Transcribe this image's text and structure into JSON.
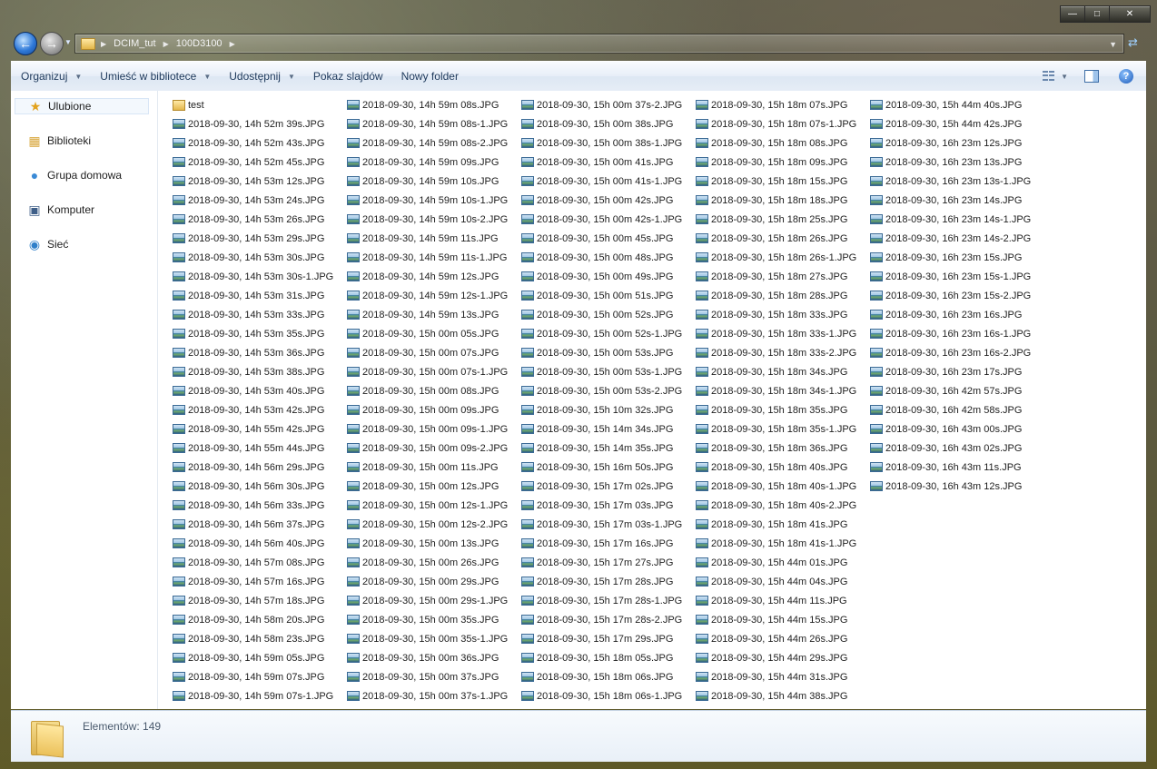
{
  "window": {
    "min_icon": "minimize-icon",
    "max_icon": "maximize-icon",
    "close_icon": "close-icon"
  },
  "address": {
    "segments": [
      "DCIM_tut",
      "100D3100"
    ]
  },
  "toolbar": {
    "organize": "Organizuj",
    "library": "Umieść w bibliotece",
    "share": "Udostępnij",
    "slideshow": "Pokaz slajdów",
    "new_folder": "Nowy folder"
  },
  "nav": {
    "items": [
      "Ulubione",
      "Biblioteki",
      "Grupa domowa",
      "Komputer",
      "Sieć"
    ]
  },
  "status": {
    "count": "Elementów: 149"
  },
  "files": [
    [
      "test",
      "2018-09-30, 14h 52m 39s.JPG",
      "2018-09-30, 14h 52m 43s.JPG",
      "2018-09-30, 14h 52m 45s.JPG",
      "2018-09-30, 14h 53m 12s.JPG",
      "2018-09-30, 14h 53m 24s.JPG",
      "2018-09-30, 14h 53m 26s.JPG",
      "2018-09-30, 14h 53m 29s.JPG",
      "2018-09-30, 14h 53m 30s.JPG",
      "2018-09-30, 14h 53m 30s-1.JPG",
      "2018-09-30, 14h 53m 31s.JPG",
      "2018-09-30, 14h 53m 33s.JPG",
      "2018-09-30, 14h 53m 35s.JPG",
      "2018-09-30, 14h 53m 36s.JPG",
      "2018-09-30, 14h 53m 38s.JPG",
      "2018-09-30, 14h 53m 40s.JPG",
      "2018-09-30, 14h 53m 42s.JPG",
      "2018-09-30, 14h 55m 42s.JPG",
      "2018-09-30, 14h 55m 44s.JPG",
      "2018-09-30, 14h 56m 29s.JPG",
      "2018-09-30, 14h 56m 30s.JPG",
      "2018-09-30, 14h 56m 33s.JPG",
      "2018-09-30, 14h 56m 37s.JPG",
      "2018-09-30, 14h 56m 40s.JPG",
      "2018-09-30, 14h 57m 08s.JPG",
      "2018-09-30, 14h 57m 16s.JPG",
      "2018-09-30, 14h 57m 18s.JPG",
      "2018-09-30, 14h 58m 20s.JPG",
      "2018-09-30, 14h 58m 23s.JPG",
      "2018-09-30, 14h 59m 05s.JPG",
      "2018-09-30, 14h 59m 07s.JPG",
      "2018-09-30, 14h 59m 07s-1.JPG"
    ],
    [
      "2018-09-30, 14h 59m 08s.JPG",
      "2018-09-30, 14h 59m 08s-1.JPG",
      "2018-09-30, 14h 59m 08s-2.JPG",
      "2018-09-30, 14h 59m 09s.JPG",
      "2018-09-30, 14h 59m 10s.JPG",
      "2018-09-30, 14h 59m 10s-1.JPG",
      "2018-09-30, 14h 59m 10s-2.JPG",
      "2018-09-30, 14h 59m 11s.JPG",
      "2018-09-30, 14h 59m 11s-1.JPG",
      "2018-09-30, 14h 59m 12s.JPG",
      "2018-09-30, 14h 59m 12s-1.JPG",
      "2018-09-30, 14h 59m 13s.JPG",
      "2018-09-30, 15h 00m 05s.JPG",
      "2018-09-30, 15h 00m 07s.JPG",
      "2018-09-30, 15h 00m 07s-1.JPG",
      "2018-09-30, 15h 00m 08s.JPG",
      "2018-09-30, 15h 00m 09s.JPG",
      "2018-09-30, 15h 00m 09s-1.JPG",
      "2018-09-30, 15h 00m 09s-2.JPG",
      "2018-09-30, 15h 00m 11s.JPG",
      "2018-09-30, 15h 00m 12s.JPG",
      "2018-09-30, 15h 00m 12s-1.JPG",
      "2018-09-30, 15h 00m 12s-2.JPG",
      "2018-09-30, 15h 00m 13s.JPG",
      "2018-09-30, 15h 00m 26s.JPG",
      "2018-09-30, 15h 00m 29s.JPG",
      "2018-09-30, 15h 00m 29s-1.JPG",
      "2018-09-30, 15h 00m 35s.JPG",
      "2018-09-30, 15h 00m 35s-1.JPG",
      "2018-09-30, 15h 00m 36s.JPG",
      "2018-09-30, 15h 00m 37s.JPG",
      "2018-09-30, 15h 00m 37s-1.JPG"
    ],
    [
      "2018-09-30, 15h 00m 37s-2.JPG",
      "2018-09-30, 15h 00m 38s.JPG",
      "2018-09-30, 15h 00m 38s-1.JPG",
      "2018-09-30, 15h 00m 41s.JPG",
      "2018-09-30, 15h 00m 41s-1.JPG",
      "2018-09-30, 15h 00m 42s.JPG",
      "2018-09-30, 15h 00m 42s-1.JPG",
      "2018-09-30, 15h 00m 45s.JPG",
      "2018-09-30, 15h 00m 48s.JPG",
      "2018-09-30, 15h 00m 49s.JPG",
      "2018-09-30, 15h 00m 51s.JPG",
      "2018-09-30, 15h 00m 52s.JPG",
      "2018-09-30, 15h 00m 52s-1.JPG",
      "2018-09-30, 15h 00m 53s.JPG",
      "2018-09-30, 15h 00m 53s-1.JPG",
      "2018-09-30, 15h 00m 53s-2.JPG",
      "2018-09-30, 15h 10m 32s.JPG",
      "2018-09-30, 15h 14m 34s.JPG",
      "2018-09-30, 15h 14m 35s.JPG",
      "2018-09-30, 15h 16m 50s.JPG",
      "2018-09-30, 15h 17m 02s.JPG",
      "2018-09-30, 15h 17m 03s.JPG",
      "2018-09-30, 15h 17m 03s-1.JPG",
      "2018-09-30, 15h 17m 16s.JPG",
      "2018-09-30, 15h 17m 27s.JPG",
      "2018-09-30, 15h 17m 28s.JPG",
      "2018-09-30, 15h 17m 28s-1.JPG",
      "2018-09-30, 15h 17m 28s-2.JPG",
      "2018-09-30, 15h 17m 29s.JPG",
      "2018-09-30, 15h 18m 05s.JPG",
      "2018-09-30, 15h 18m 06s.JPG",
      "2018-09-30, 15h 18m 06s-1.JPG"
    ],
    [
      "2018-09-30, 15h 18m 07s.JPG",
      "2018-09-30, 15h 18m 07s-1.JPG",
      "2018-09-30, 15h 18m 08s.JPG",
      "2018-09-30, 15h 18m 09s.JPG",
      "2018-09-30, 15h 18m 15s.JPG",
      "2018-09-30, 15h 18m 18s.JPG",
      "2018-09-30, 15h 18m 25s.JPG",
      "2018-09-30, 15h 18m 26s.JPG",
      "2018-09-30, 15h 18m 26s-1.JPG",
      "2018-09-30, 15h 18m 27s.JPG",
      "2018-09-30, 15h 18m 28s.JPG",
      "2018-09-30, 15h 18m 33s.JPG",
      "2018-09-30, 15h 18m 33s-1.JPG",
      "2018-09-30, 15h 18m 33s-2.JPG",
      "2018-09-30, 15h 18m 34s.JPG",
      "2018-09-30, 15h 18m 34s-1.JPG",
      "2018-09-30, 15h 18m 35s.JPG",
      "2018-09-30, 15h 18m 35s-1.JPG",
      "2018-09-30, 15h 18m 36s.JPG",
      "2018-09-30, 15h 18m 40s.JPG",
      "2018-09-30, 15h 18m 40s-1.JPG",
      "2018-09-30, 15h 18m 40s-2.JPG",
      "2018-09-30, 15h 18m 41s.JPG",
      "2018-09-30, 15h 18m 41s-1.JPG",
      "2018-09-30, 15h 44m 01s.JPG",
      "2018-09-30, 15h 44m 04s.JPG",
      "2018-09-30, 15h 44m 11s.JPG",
      "2018-09-30, 15h 44m 15s.JPG",
      "2018-09-30, 15h 44m 26s.JPG",
      "2018-09-30, 15h 44m 29s.JPG",
      "2018-09-30, 15h 44m 31s.JPG",
      "2018-09-30, 15h 44m 38s.JPG"
    ],
    [
      "2018-09-30, 15h 44m 40s.JPG",
      "2018-09-30, 15h 44m 42s.JPG",
      "2018-09-30, 16h 23m 12s.JPG",
      "2018-09-30, 16h 23m 13s.JPG",
      "2018-09-30, 16h 23m 13s-1.JPG",
      "2018-09-30, 16h 23m 14s.JPG",
      "2018-09-30, 16h 23m 14s-1.JPG",
      "2018-09-30, 16h 23m 14s-2.JPG",
      "2018-09-30, 16h 23m 15s.JPG",
      "2018-09-30, 16h 23m 15s-1.JPG",
      "2018-09-30, 16h 23m 15s-2.JPG",
      "2018-09-30, 16h 23m 16s.JPG",
      "2018-09-30, 16h 23m 16s-1.JPG",
      "2018-09-30, 16h 23m 16s-2.JPG",
      "2018-09-30, 16h 23m 17s.JPG",
      "2018-09-30, 16h 42m 57s.JPG",
      "2018-09-30, 16h 42m 58s.JPG",
      "2018-09-30, 16h 43m 00s.JPG",
      "2018-09-30, 16h 43m 02s.JPG",
      "2018-09-30, 16h 43m 11s.JPG",
      "2018-09-30, 16h 43m 12s.JPG"
    ]
  ]
}
